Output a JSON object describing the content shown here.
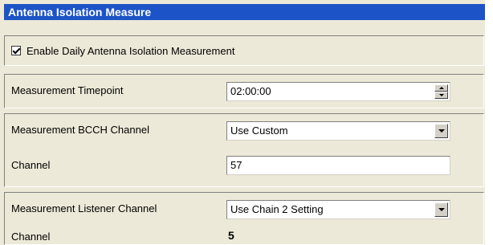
{
  "panel": {
    "title": "Antenna Isolation Measure"
  },
  "enable": {
    "label": "Enable Daily Antenna Isolation Measurement",
    "checked": true
  },
  "timepoint": {
    "label": "Measurement Timepoint",
    "value": "02:00:00"
  },
  "bcch": {
    "label": "Measurement BCCH Channel",
    "selected": "Use Custom",
    "channel_label": "Channel",
    "channel_value": "57"
  },
  "listener": {
    "label": "Measurement Listener Channel",
    "selected": "Use Chain 2 Setting",
    "channel_label": "Channel",
    "channel_value": "5"
  },
  "icons": {
    "spin": "spin-arrows-icon",
    "dropdown": "chevron-down-icon"
  },
  "colors": {
    "title_bar": "#1c53c7",
    "panel_bg": "#ece9d8"
  }
}
